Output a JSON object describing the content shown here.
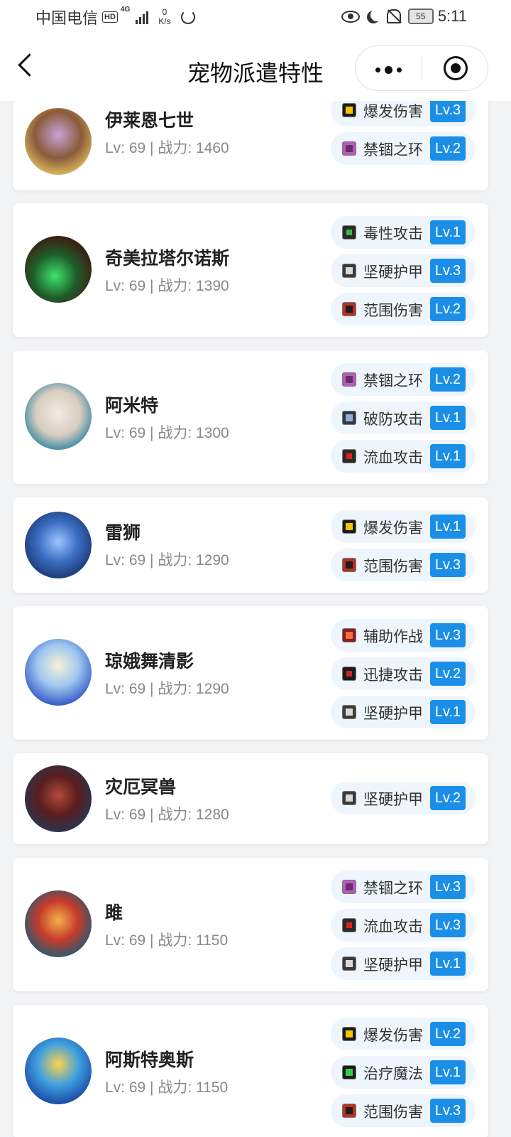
{
  "status_bar": {
    "carrier": "中国电信",
    "hd": "HD",
    "network": "4G",
    "speed_value": "0",
    "speed_unit": "K/s",
    "battery": "55",
    "time": "5:11"
  },
  "nav": {
    "title": "宠物派遣特性"
  },
  "pets": [
    {
      "name": "伊莱恩七世",
      "stats": "Lv: 69 | 战力: 1460",
      "traits": [
        {
          "name": "爆发伤害",
          "level": "Lv.3",
          "icon": "burst-icon"
        },
        {
          "name": "禁锢之环",
          "level": "Lv.2",
          "icon": "bind-icon"
        }
      ]
    },
    {
      "name": "奇美拉塔尔诺斯",
      "stats": "Lv: 69 | 战力: 1390",
      "traits": [
        {
          "name": "毒性攻击",
          "level": "Lv.1",
          "icon": "poison-icon"
        },
        {
          "name": "坚硬护甲",
          "level": "Lv.3",
          "icon": "armor-icon"
        },
        {
          "name": "范围伤害",
          "level": "Lv.2",
          "icon": "area-icon"
        }
      ]
    },
    {
      "name": "阿米特",
      "stats": "Lv: 69 | 战力: 1300",
      "traits": [
        {
          "name": "禁锢之环",
          "level": "Lv.2",
          "icon": "bind-icon"
        },
        {
          "name": "破防攻击",
          "level": "Lv.1",
          "icon": "pierce-icon"
        },
        {
          "name": "流血攻击",
          "level": "Lv.1",
          "icon": "bleed-icon"
        }
      ]
    },
    {
      "name": "雷狮",
      "stats": "Lv: 69 | 战力: 1290",
      "traits": [
        {
          "name": "爆发伤害",
          "level": "Lv.1",
          "icon": "burst-icon"
        },
        {
          "name": "范围伤害",
          "level": "Lv.3",
          "icon": "area-icon"
        }
      ]
    },
    {
      "name": "琼娥舞清影",
      "stats": "Lv: 69 | 战力: 1290",
      "traits": [
        {
          "name": "辅助作战",
          "level": "Lv.3",
          "icon": "support-icon"
        },
        {
          "name": "迅捷攻击",
          "level": "Lv.2",
          "icon": "swift-icon"
        },
        {
          "name": "坚硬护甲",
          "level": "Lv.1",
          "icon": "armor-icon"
        }
      ]
    },
    {
      "name": "灾厄冥兽",
      "stats": "Lv: 69 | 战力: 1280",
      "traits": [
        {
          "name": "坚硬护甲",
          "level": "Lv.2",
          "icon": "armor-icon"
        }
      ]
    },
    {
      "name": "雎",
      "stats": "Lv: 69 | 战力: 1150",
      "traits": [
        {
          "name": "禁锢之环",
          "level": "Lv.3",
          "icon": "bind-icon"
        },
        {
          "name": "流血攻击",
          "level": "Lv.3",
          "icon": "bleed-icon"
        },
        {
          "name": "坚硬护甲",
          "level": "Lv.1",
          "icon": "armor-icon"
        }
      ]
    },
    {
      "name": "阿斯特奥斯",
      "stats": "Lv: 69 | 战力: 1150",
      "traits": [
        {
          "name": "爆发伤害",
          "level": "Lv.2",
          "icon": "burst-icon"
        },
        {
          "name": "治疗魔法",
          "level": "Lv.1",
          "icon": "heal-icon"
        },
        {
          "name": "范围伤害",
          "level": "Lv.3",
          "icon": "area-icon"
        }
      ]
    }
  ]
}
